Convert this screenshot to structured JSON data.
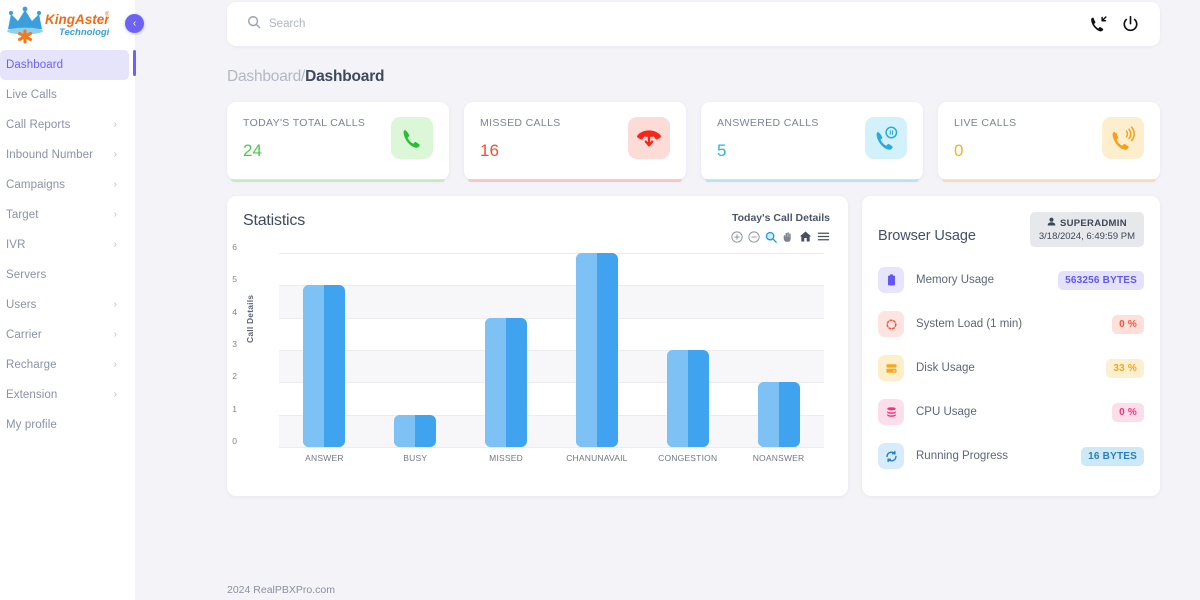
{
  "brand": {
    "name_1": "KingAsterisk",
    "name_2": "Technologies",
    "registered": "®",
    "crown_color": "#3aa0dd",
    "asterisk_color": "#f5781f",
    "name_1_color": "#ef6c1a",
    "name_2_color": "#3a9fd8"
  },
  "sidebar": {
    "collapse_icon": "‹",
    "items": [
      {
        "label": "Dashboard",
        "chevron": "",
        "active": true
      },
      {
        "label": "Live Calls",
        "chevron": "",
        "active": false
      },
      {
        "label": "Call Reports",
        "chevron": "›",
        "active": false
      },
      {
        "label": "Inbound Number",
        "chevron": "›",
        "active": false
      },
      {
        "label": "Campaigns",
        "chevron": "›",
        "active": false
      },
      {
        "label": "Target",
        "chevron": "›",
        "active": false
      },
      {
        "label": "IVR",
        "chevron": "›",
        "active": false
      },
      {
        "label": "Servers",
        "chevron": "",
        "active": false
      },
      {
        "label": "Users",
        "chevron": "›",
        "active": false
      },
      {
        "label": "Carrier",
        "chevron": "›",
        "active": false
      },
      {
        "label": "Recharge",
        "chevron": "›",
        "active": false
      },
      {
        "label": "Extension",
        "chevron": "›",
        "active": false
      },
      {
        "label": "My profile",
        "chevron": "",
        "active": false
      }
    ]
  },
  "topbar": {
    "search_placeholder": "Search",
    "search_value": "",
    "icons": [
      "search-icon",
      "incoming-call-icon",
      "power-icon"
    ]
  },
  "breadcrumb": {
    "parent": "Dashboard",
    "separator": "/",
    "current": "Dashboard"
  },
  "cards": [
    {
      "title": "TODAY'S TOTAL CALLS",
      "value": "24",
      "accent": "#4bcb49",
      "icon": "phone-icon",
      "tone": "green"
    },
    {
      "title": "MISSED CALLS",
      "value": "16",
      "accent": "#fb4c32",
      "icon": "missed-call-icon",
      "tone": "red"
    },
    {
      "title": "ANSWERED CALLS",
      "value": "5",
      "accent": "#2bb4e8",
      "icon": "answered-call-icon",
      "tone": "blue"
    },
    {
      "title": "LIVE CAllS",
      "value": "0",
      "accent": "#f5b221",
      "icon": "live-call-icon",
      "tone": "orange"
    }
  ],
  "statistics": {
    "title": "Statistics",
    "subtitle": "Today's Call Details",
    "toolbar": [
      {
        "name": "zoom-in-icon",
        "glyph": "⊕",
        "active": false
      },
      {
        "name": "zoom-out-icon",
        "glyph": "⊖",
        "active": false
      },
      {
        "name": "selection-zoom-icon",
        "glyph": "🔍",
        "active": true
      },
      {
        "name": "panning-icon",
        "glyph": "✋",
        "active": false
      },
      {
        "name": "reset-zoom-icon",
        "glyph": "⌂",
        "active": false
      },
      {
        "name": "menu-icon",
        "glyph": "☰",
        "active": false
      }
    ]
  },
  "chart_data": {
    "type": "bar",
    "title": "Statistics",
    "subtitle": "Today's Call Details",
    "categories": [
      "ANSWER",
      "BUSY",
      "MISSED",
      "CHANUNAVAIL",
      "CONGESTION",
      "NOANSWER"
    ],
    "values": [
      5,
      1,
      4,
      6,
      3,
      2
    ],
    "series": [
      {
        "name": "Call Details",
        "values": [
          5,
          1,
          4,
          6,
          3,
          2
        ]
      }
    ],
    "xlabel": "",
    "ylabel": "Call Details",
    "ylim": [
      0,
      6
    ],
    "yticks": [
      0,
      1,
      2,
      3,
      4,
      5,
      6
    ],
    "grid": true,
    "legend": false,
    "bar_color": "#3fa3ef",
    "bar_highlight_color": "#7ec2f5"
  },
  "browser_usage": {
    "title": "Browser Usage",
    "user": "SUPERADMIN",
    "timestamp": "3/18/2024, 6:49:59 PM",
    "rows": [
      {
        "label": "Memory Usage",
        "value": "563256 BYTES",
        "icon": "memory-icon",
        "icon_bg": "#e7e5fd",
        "icon_color": "#6257f0",
        "val_bg": "#e4e2fb",
        "val_color": "#6257f0"
      },
      {
        "label": "System Load (1 min)",
        "value": "0 %",
        "icon": "load-icon",
        "icon_bg": "#fde4e0",
        "icon_color": "#f4563b",
        "val_bg": "#fde0da",
        "val_color": "#f4563b"
      },
      {
        "label": "Disk Usage",
        "value": "33 %",
        "icon": "disk-icon",
        "icon_bg": "#fdeecc",
        "icon_color": "#f4a81e",
        "val_bg": "#fdefd1",
        "val_color": "#f0a81e"
      },
      {
        "label": "CPU Usage",
        "value": "0 %",
        "icon": "cpu-icon",
        "icon_bg": "#fcdeea",
        "icon_color": "#f0357f",
        "val_bg": "#fcdeea",
        "val_color": "#f0357f"
      },
      {
        "label": "Running Progress",
        "value": "16 BYTES",
        "icon": "progress-icon",
        "icon_bg": "#d6ecfa",
        "icon_color": "#2a7fc4",
        "val_bg": "#cde9f8",
        "val_color": "#2a7fc4"
      }
    ]
  },
  "footer": {
    "text": "2024 RealPBXPro.com"
  }
}
